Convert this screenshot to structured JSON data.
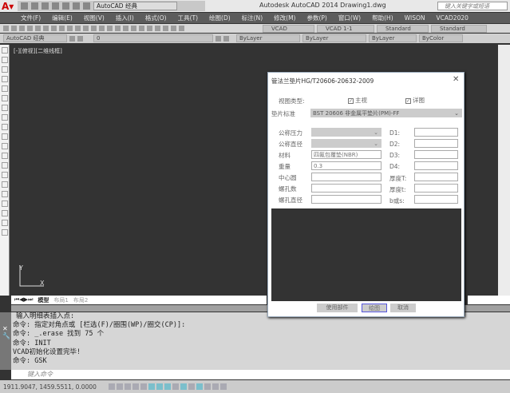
{
  "titlebar": {
    "app_title": "Autodesk AutoCAD 2014     Drawing1.dwg",
    "workspace": "AutoCAD 经典",
    "search_placeholder": "键入关键字或短语"
  },
  "menu": [
    "文件(F)",
    "编辑(E)",
    "视图(V)",
    "插入(I)",
    "格式(O)",
    "工具(T)",
    "绘图(D)",
    "标注(N)",
    "修改(M)",
    "参数(P)",
    "窗口(W)",
    "帮助(H)",
    "WISON",
    "VCAD2020"
  ],
  "toolbar1": {
    "style1": "VCAD",
    "style2": "VCAD 1-1",
    "style3": "Standard",
    "style4": "Standard"
  },
  "toolbar2": {
    "workspace": "AutoCAD 经典",
    "layer": "0",
    "color": "ByLayer",
    "linetype": "ByLayer",
    "lineweight": "ByLayer",
    "plotstyle": "ByColor"
  },
  "viewport_label": "[-][俯视][二维线框]",
  "tabs": [
    "模型",
    "布局1",
    "布局2"
  ],
  "command_history": [
    "输入明细表插入点:",
    "命令: 指定对角点或 [栏选(F)/圈围(WP)/圈交(CP)]:",
    "命令: _.erase 找到 75 个",
    "命令: INIT",
    "VCAD初始化设置完毕!",
    "命令: GSK"
  ],
  "command_placeholder": "键入命令",
  "status": {
    "coords": "1911.9047, 1459.5511, 0.0000"
  },
  "dialog": {
    "title": "管法兰垫片HG/T20606-20632-2009",
    "view_type_label": "视图类型:",
    "main_view": "主视",
    "detail_view": "详图",
    "main_view_checked": true,
    "detail_view_checked": true,
    "standard_label": "垫片标准",
    "standard_value": "BST 20606 非金属平垫片(PM)-FF",
    "left_fields": [
      {
        "label": "公称压力",
        "value": "",
        "disabled": true
      },
      {
        "label": "公称直径",
        "value": "",
        "disabled": true
      },
      {
        "label": "材料",
        "value": "四氟包覆垫(NBR)"
      },
      {
        "label": "重量",
        "value": "0.3"
      },
      {
        "label": "中心圆",
        "value": ""
      },
      {
        "label": "螺孔数",
        "value": ""
      },
      {
        "label": "螺孔直径",
        "value": ""
      }
    ],
    "right_fields": [
      {
        "label": "D1:",
        "value": ""
      },
      {
        "label": "D2:",
        "value": ""
      },
      {
        "label": "D3:",
        "value": ""
      },
      {
        "label": "D4:",
        "value": ""
      },
      {
        "label": "厚度T:",
        "value": ""
      },
      {
        "label": "厚度t:",
        "value": ""
      },
      {
        "label": "b或s:",
        "value": ""
      }
    ],
    "buttons": {
      "use_part": "使用部件",
      "draw": "绘图",
      "cancel": "取消"
    }
  }
}
